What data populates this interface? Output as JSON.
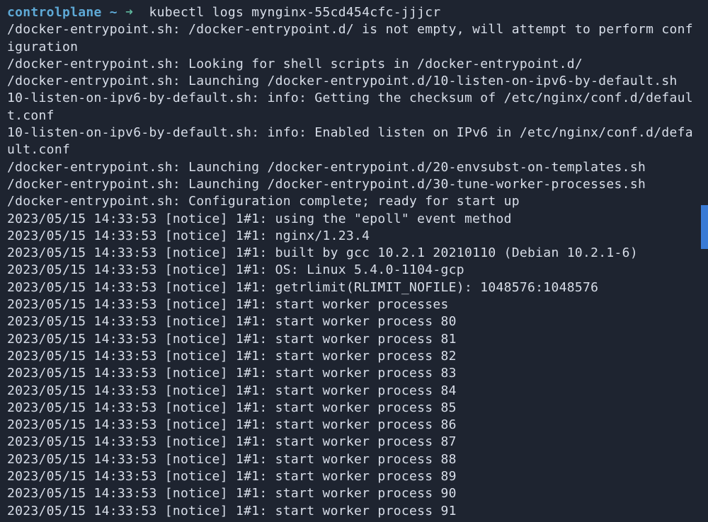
{
  "prompt": {
    "host": "controlplane",
    "tilde": " ~ ",
    "arrow": "➜",
    "spacer": "  ",
    "command": "kubectl logs mynginx-55cd454cfc-jjjcr"
  },
  "lines": [
    "/docker-entrypoint.sh: /docker-entrypoint.d/ is not empty, will attempt to perform configuration",
    "/docker-entrypoint.sh: Looking for shell scripts in /docker-entrypoint.d/",
    "/docker-entrypoint.sh: Launching /docker-entrypoint.d/10-listen-on-ipv6-by-default.sh",
    "10-listen-on-ipv6-by-default.sh: info: Getting the checksum of /etc/nginx/conf.d/default.conf",
    "10-listen-on-ipv6-by-default.sh: info: Enabled listen on IPv6 in /etc/nginx/conf.d/default.conf",
    "/docker-entrypoint.sh: Launching /docker-entrypoint.d/20-envsubst-on-templates.sh",
    "/docker-entrypoint.sh: Launching /docker-entrypoint.d/30-tune-worker-processes.sh",
    "/docker-entrypoint.sh: Configuration complete; ready for start up",
    "2023/05/15 14:33:53 [notice] 1#1: using the \"epoll\" event method",
    "2023/05/15 14:33:53 [notice] 1#1: nginx/1.23.4",
    "2023/05/15 14:33:53 [notice] 1#1: built by gcc 10.2.1 20210110 (Debian 10.2.1-6)",
    "2023/05/15 14:33:53 [notice] 1#1: OS: Linux 5.4.0-1104-gcp",
    "2023/05/15 14:33:53 [notice] 1#1: getrlimit(RLIMIT_NOFILE): 1048576:1048576",
    "2023/05/15 14:33:53 [notice] 1#1: start worker processes",
    "2023/05/15 14:33:53 [notice] 1#1: start worker process 80",
    "2023/05/15 14:33:53 [notice] 1#1: start worker process 81",
    "2023/05/15 14:33:53 [notice] 1#1: start worker process 82",
    "2023/05/15 14:33:53 [notice] 1#1: start worker process 83",
    "2023/05/15 14:33:53 [notice] 1#1: start worker process 84",
    "2023/05/15 14:33:53 [notice] 1#1: start worker process 85",
    "2023/05/15 14:33:53 [notice] 1#1: start worker process 86",
    "2023/05/15 14:33:53 [notice] 1#1: start worker process 87",
    "2023/05/15 14:33:53 [notice] 1#1: start worker process 88",
    "2023/05/15 14:33:53 [notice] 1#1: start worker process 89",
    "2023/05/15 14:33:53 [notice] 1#1: start worker process 90",
    "2023/05/15 14:33:53 [notice] 1#1: start worker process 91"
  ]
}
